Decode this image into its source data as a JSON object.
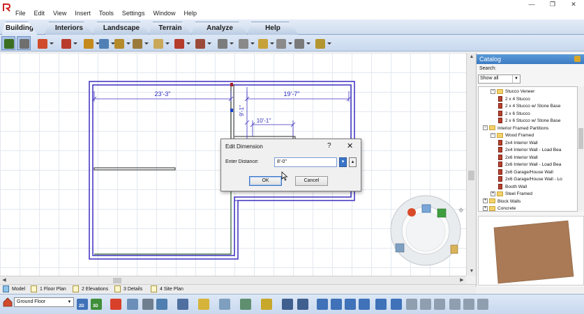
{
  "menu": {
    "items": [
      "File",
      "Edit",
      "View",
      "Insert",
      "Tools",
      "Settings",
      "Window",
      "Help"
    ]
  },
  "window": {
    "minimize": "—",
    "restore": "❐",
    "close": "✕"
  },
  "ribbon": {
    "tabs": [
      "Building",
      "Interiors",
      "Landscape",
      "Terrain",
      "Analyze",
      "Help"
    ],
    "active": "Building"
  },
  "toolbar": {
    "icons": [
      {
        "name": "select-pointer-icon",
        "color": "#3b6e20"
      },
      {
        "name": "paint-brush-icon",
        "color": "#6f6f6f"
      },
      {
        "name": "house-icon",
        "color": "#d04a2c"
      },
      {
        "name": "wall-tool-icon",
        "color": "#b93b2c"
      },
      {
        "name": "door-icon",
        "color": "#c48a1e"
      },
      {
        "name": "window-icon",
        "color": "#4f7fb5"
      },
      {
        "name": "stairs-icon",
        "color": "#b48a2b"
      },
      {
        "name": "cabinet-icon",
        "color": "#9b7a3a"
      },
      {
        "name": "floor-icon",
        "color": "#c9a85a"
      },
      {
        "name": "roof-icon",
        "color": "#b53b2a"
      },
      {
        "name": "skylight-icon",
        "color": "#9b4a3a"
      },
      {
        "name": "railing-icon",
        "color": "#7c7c7c"
      },
      {
        "name": "shelf-icon",
        "color": "#8a8a8a"
      },
      {
        "name": "column-icon",
        "color": "#c7a23a"
      },
      {
        "name": "fireplace-icon",
        "color": "#8b8b8b"
      },
      {
        "name": "molding-icon",
        "color": "#7a7a7a"
      },
      {
        "name": "cabinet-box-icon",
        "color": "#b3962f"
      }
    ]
  },
  "plan": {
    "dimensions": {
      "left_width": "23'-3\"",
      "right_width": "19'-7\"",
      "vertical": "9'-1\"",
      "inner_width": "10'-1\""
    }
  },
  "dialog": {
    "title": "Edit Dimension",
    "help": "?",
    "close": "✕",
    "label": "Enter Distance:",
    "value": "8'-0\"",
    "spin_down": "▾",
    "spin_up": "▴",
    "ok": "OK",
    "cancel": "Cancel"
  },
  "catalog": {
    "title": "Catalog",
    "search_label": "Search:",
    "filter": "Show all",
    "tree": [
      {
        "indent": 1,
        "kind": "folder",
        "toggle": "−",
        "label": "Stucco Veneer"
      },
      {
        "indent": 2,
        "kind": "item",
        "label": "2 x 4 Stucco"
      },
      {
        "indent": 2,
        "kind": "item",
        "label": "2 x 4 Stucco w/ Stone Base"
      },
      {
        "indent": 2,
        "kind": "item",
        "label": "2 x 6 Stucco"
      },
      {
        "indent": 2,
        "kind": "item",
        "label": "2 x 6 Stucco w/ Stone Base"
      },
      {
        "indent": 0,
        "kind": "folder",
        "toggle": "−",
        "label": "Interior Framed Partitions"
      },
      {
        "indent": 1,
        "kind": "folder",
        "toggle": "−",
        "label": "Wood Framed"
      },
      {
        "indent": 2,
        "kind": "item",
        "label": "2x4 Interior Wall"
      },
      {
        "indent": 2,
        "kind": "item",
        "label": "2x4 Interior Wall - Load Bea"
      },
      {
        "indent": 2,
        "kind": "item",
        "label": "2x6 Interior Wall"
      },
      {
        "indent": 2,
        "kind": "item",
        "label": "2x6 Interior Wall - Load Bea"
      },
      {
        "indent": 2,
        "kind": "item",
        "label": "2x6 Garage/House Wall"
      },
      {
        "indent": 2,
        "kind": "item",
        "label": "2x6 Garage/House Wall - Lo"
      },
      {
        "indent": 2,
        "kind": "item",
        "label": "Booth Wall"
      },
      {
        "indent": 1,
        "kind": "folder",
        "toggle": "+",
        "label": "Steel Framed"
      },
      {
        "indent": 0,
        "kind": "folder",
        "toggle": "+",
        "label": "Block Walls"
      },
      {
        "indent": 0,
        "kind": "folder",
        "toggle": "+",
        "label": "Concrete"
      }
    ],
    "preview_color": "#a97a55"
  },
  "view_tabs": [
    {
      "label": "Model",
      "name": "model"
    },
    {
      "label": "1 Floor Plan",
      "name": "floor-plan"
    },
    {
      "label": "2 Elevations",
      "name": "elevations"
    },
    {
      "label": "3 Details",
      "name": "details"
    },
    {
      "label": "4 Site Plan",
      "name": "site-plan"
    }
  ],
  "bottom": {
    "floor": "Ground Floor",
    "view_2d": "2D",
    "view_3d": "3D",
    "icons": [
      {
        "name": "view-2d-icon",
        "color": "#3f72b8"
      },
      {
        "name": "view-3d-icon",
        "color": "#3f8f3a"
      },
      {
        "name": "camera-3d-icon",
        "color": "#d8402a"
      },
      {
        "name": "walkthrough-icon",
        "color": "#6b8fb8"
      },
      {
        "name": "dome-icon",
        "color": "#6f7f8f"
      },
      {
        "name": "house-outline-icon",
        "color": "#4f7fb0"
      },
      {
        "name": "roof-view-icon",
        "color": "#4f6fa0"
      },
      {
        "name": "light-icon",
        "color": "#d6b43a"
      },
      {
        "name": "camera-icon",
        "color": "#7f9fbf"
      },
      {
        "name": "layer-icon",
        "color": "#5f8f6f"
      },
      {
        "name": "cube-icon",
        "color": "#c8a82a"
      },
      {
        "name": "display-icon",
        "color": "#3f5f8f"
      },
      {
        "name": "render-icon",
        "color": "#3f5f8f"
      },
      {
        "name": "zoom-in-icon",
        "color": "#3f72b8"
      },
      {
        "name": "zoom-out-icon",
        "color": "#3f72b8"
      },
      {
        "name": "zoom-window-icon",
        "color": "#3f72b8"
      },
      {
        "name": "zoom-fit-icon",
        "color": "#3f72b8"
      },
      {
        "name": "zoom-search-icon",
        "color": "#3f72b8"
      },
      {
        "name": "zoom-extents-icon",
        "color": "#3f72b8"
      },
      {
        "name": "walk-icon",
        "color": "#8f9fb0"
      },
      {
        "name": "orbit-icon",
        "color": "#8f9fb0"
      },
      {
        "name": "pan-icon",
        "color": "#8f9fb0"
      },
      {
        "name": "look-icon",
        "color": "#8f9fb0"
      },
      {
        "name": "fly-icon",
        "color": "#8f9fb0"
      },
      {
        "name": "settings-icon",
        "color": "#8f9fb0"
      }
    ]
  }
}
